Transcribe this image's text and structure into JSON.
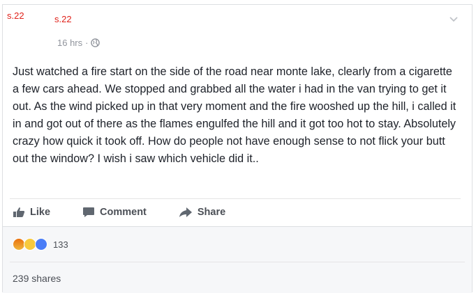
{
  "post": {
    "redacted_author_1": "s.22",
    "redacted_author_2": "s.22",
    "timestamp": "16 hrs",
    "separator": "·",
    "privacy_icon": "globe-icon",
    "options_icon": "chevron-down-icon",
    "text": "Just watched a fire start on the side of the road near monte lake, clearly from a cigarette a few cars ahead. We stopped and grabbed all the water i had in the van trying to get it out. As the wind picked up in that very moment and the fire wooshed up the hill, i called it in and got out of there as the flames engulfed the hill and it got too hot to stay. Absolutely crazy how quick it took off. How do people not have enough sense to not flick your butt out the window? I wish i saw which vehicle did it.."
  },
  "actions": {
    "like_label": "Like",
    "comment_label": "Comment",
    "share_label": "Share"
  },
  "reactions": {
    "types": [
      "angry",
      "wow",
      "like"
    ],
    "count": "133"
  },
  "shares": {
    "label": "239 shares"
  },
  "colors": {
    "text": "#1d2129",
    "meta": "#90949c",
    "action": "#4b4f56",
    "redaction": "#e0221b",
    "like_blue": "#4a7df7"
  }
}
